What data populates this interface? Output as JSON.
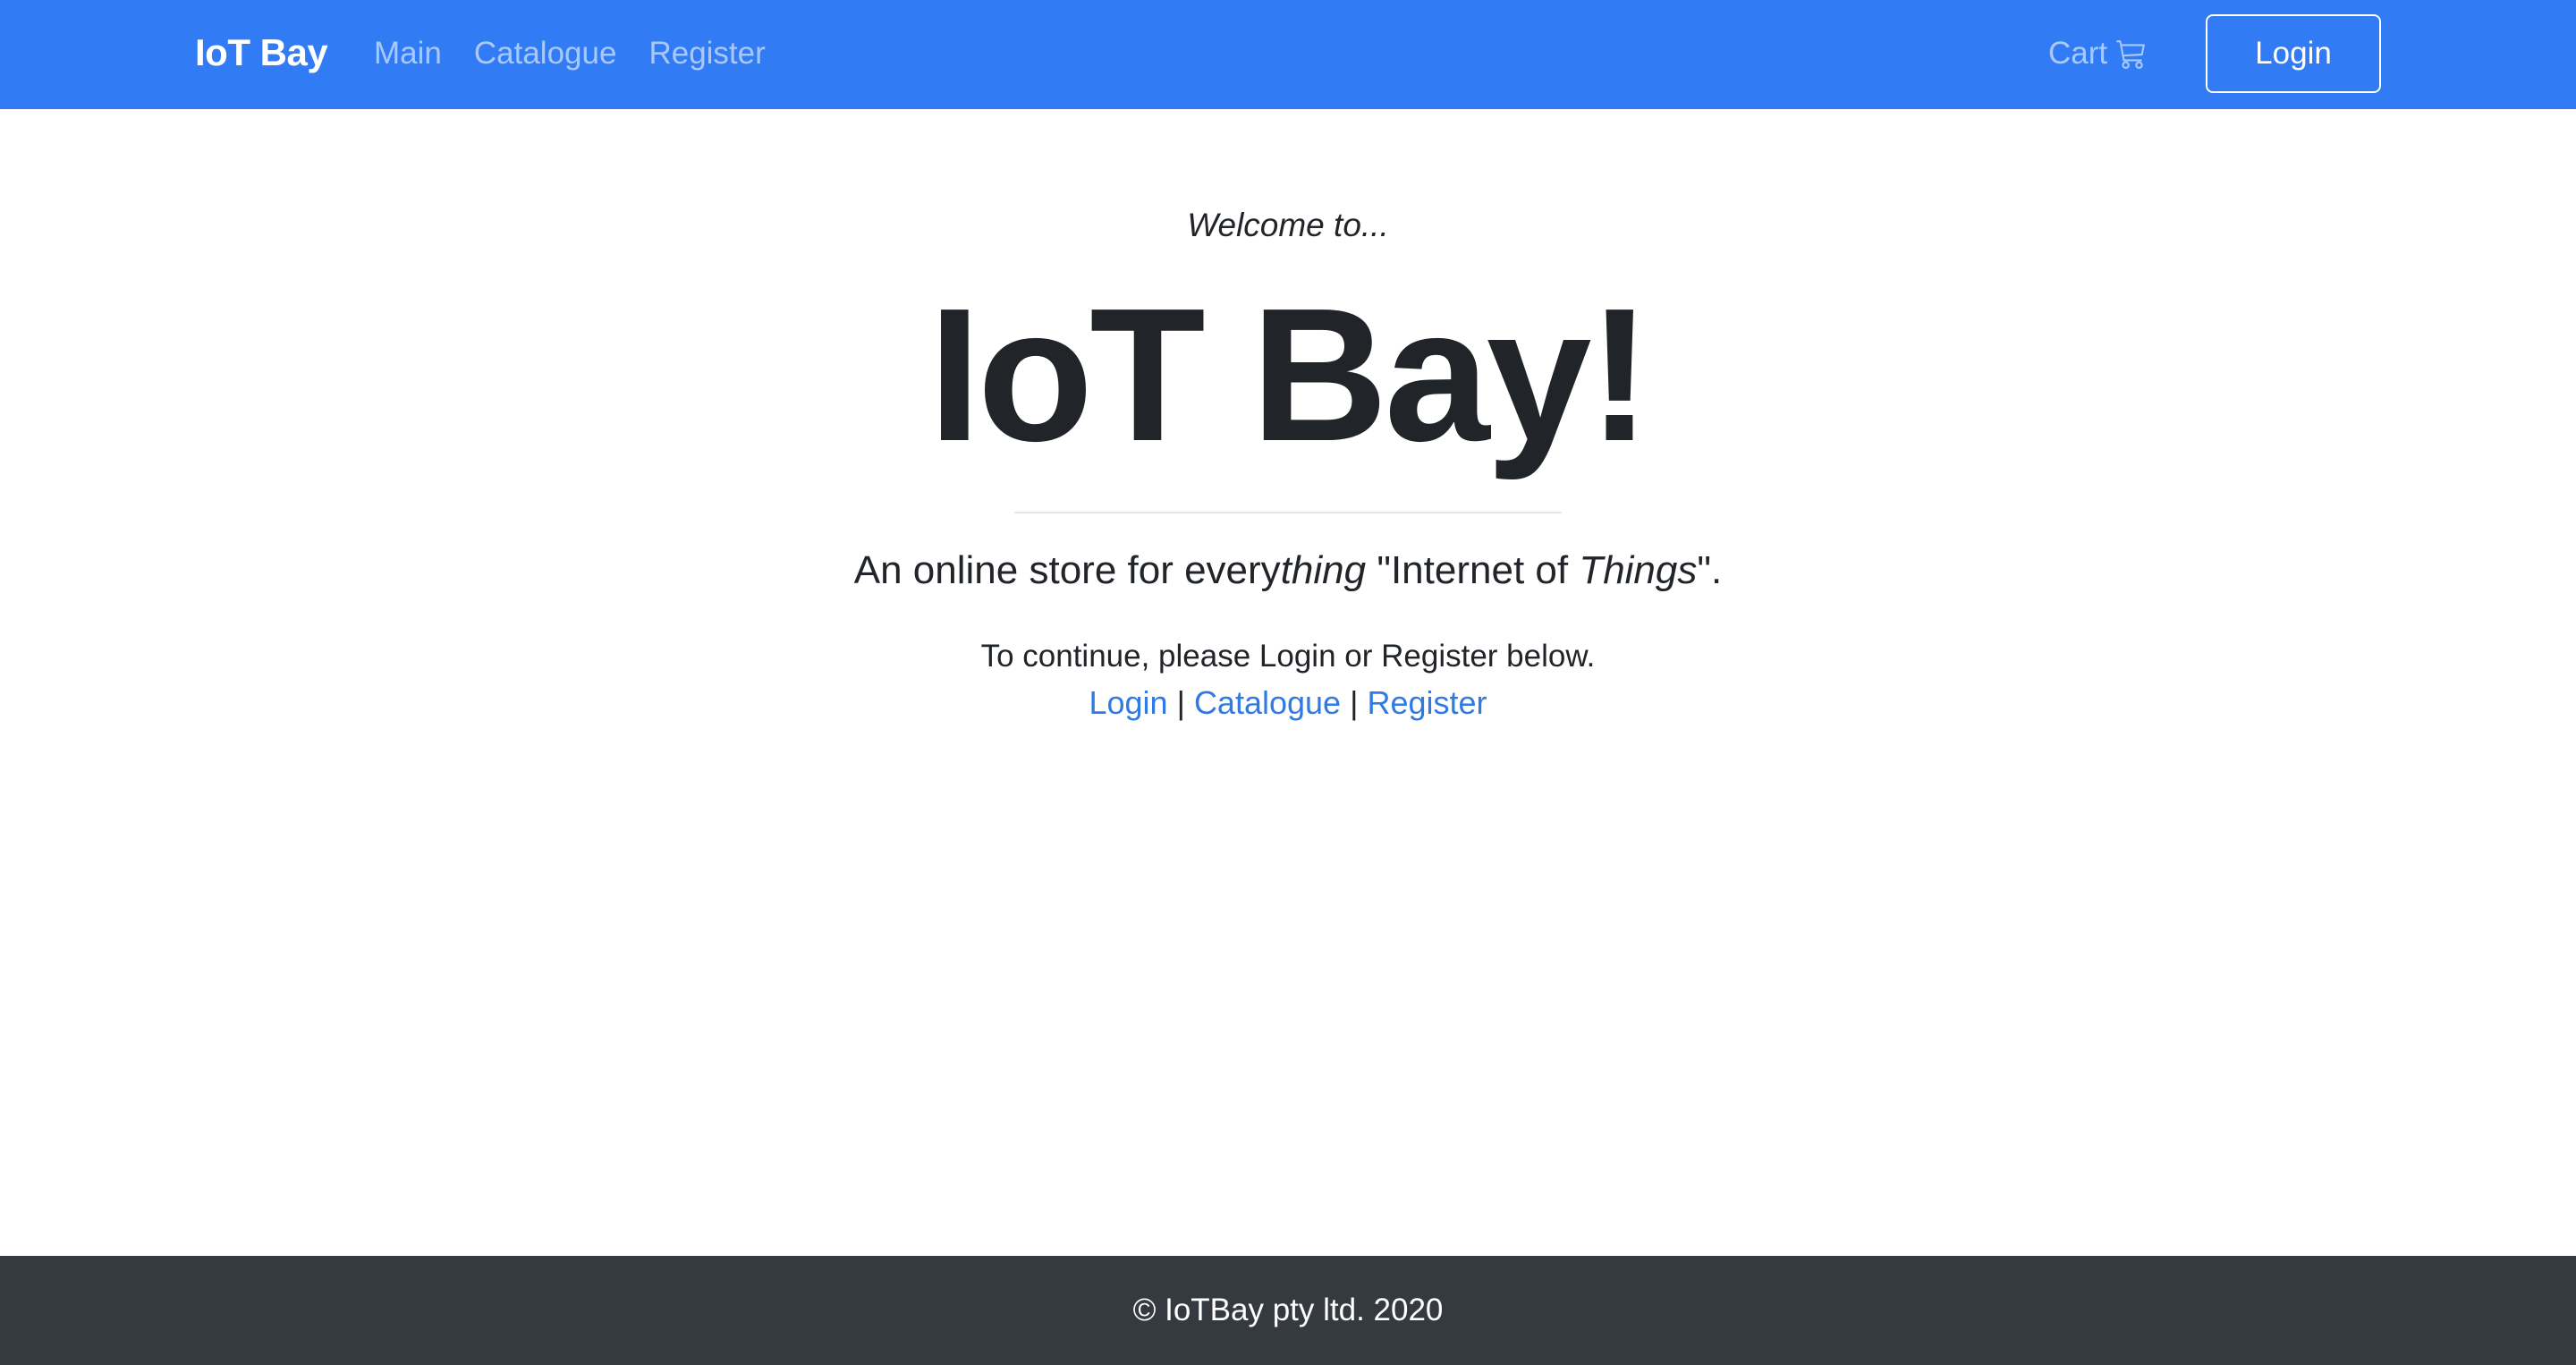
{
  "navbar": {
    "brand": "IoT Bay",
    "links": [
      {
        "label": "Main"
      },
      {
        "label": "Catalogue"
      },
      {
        "label": "Register"
      }
    ],
    "cart_label": "Cart",
    "cart_icon": "cart-icon",
    "login_label": "Login",
    "background_color": "#317cf5"
  },
  "hero": {
    "welcome": "Welcome to...",
    "title": "IoT Bay!",
    "tagline_part1": "An online store for every",
    "tagline_em1": "thing",
    "tagline_part2": " \"Internet of ",
    "tagline_em2": "Things",
    "tagline_part3": "\".",
    "instructions": "To continue, please Login or Register below.",
    "link_login": "Login",
    "separator": "|",
    "link_catalogue": "Catalogue",
    "link_register": "Register",
    "link_color": "#2f7ae5"
  },
  "footer": {
    "text": "© IoTBay pty ltd. 2020",
    "background_color": "#353a40"
  }
}
